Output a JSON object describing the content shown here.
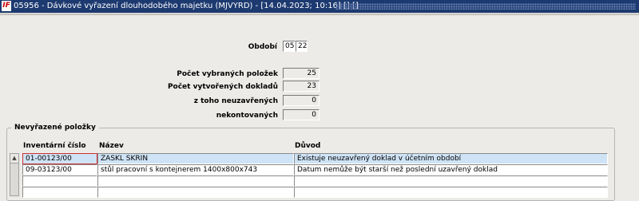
{
  "window": {
    "logo": "IF",
    "title": "05956 - Dávkové vyřazení dlouhodobého majetku (MJVYRD) - [14.04.2023; 10:16] [] []"
  },
  "form": {
    "obdobi_label": "Období",
    "obdobi_month": "05",
    "obdobi_year": "22",
    "vybranych_label": "Počet vybraných položek",
    "vybranych_value": "25",
    "dokladu_label": "Počet vytvořených dokladů",
    "dokladu_value": "23",
    "neuzavrenych_label": "z toho  neuzavřených",
    "neuzavrenych_value": "0",
    "nekontovanych_label": "nekontovaných",
    "nekontovanych_value": "0"
  },
  "group": {
    "title": "Nevyřazené položky",
    "headers": {
      "inv": "Inventární číslo",
      "nazev": "Název",
      "duvod": "Důvod"
    },
    "rows": [
      {
        "inv": "01-00123/00",
        "nazev": "ZASKL SKRIN",
        "duvod": "Existuje neuzavřený doklad v účetním období"
      },
      {
        "inv": "09-03123/00",
        "nazev": "stůl pracovní s kontejnerem 1400x800x743",
        "duvod": "Datum nemůže být starší než poslední uzavřený doklad"
      },
      {
        "inv": "",
        "nazev": "",
        "duvod": ""
      },
      {
        "inv": "",
        "nazev": "",
        "duvod": ""
      }
    ]
  },
  "icons": {
    "scroll_up": "scroll-up-arrow-icon"
  }
}
